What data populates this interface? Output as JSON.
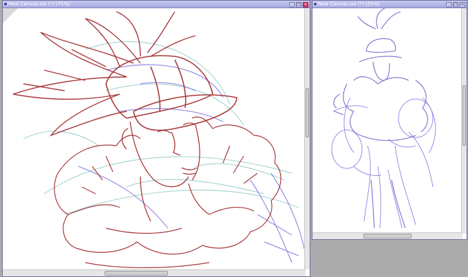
{
  "colors": {
    "title_gradient_top": "#c7c9ef",
    "title_gradient_bottom": "#a7aae2",
    "close_button": "#d8336f",
    "sketch_red": "#a8383a",
    "sketch_blue": "#8f7fe0",
    "sketch_cyan": "#9fd3cf",
    "workspace_bg": "#ababab"
  },
  "left_window": {
    "title": "New Canvas.sai (*) (75%)",
    "icons": [
      "minimize-icon",
      "maximize-icon",
      "close-icon"
    ]
  },
  "right_window": {
    "title": "New Canvas.sai (*) (25%)",
    "icons": [
      "minimize-icon",
      "maximize-icon",
      "close-icon"
    ]
  }
}
